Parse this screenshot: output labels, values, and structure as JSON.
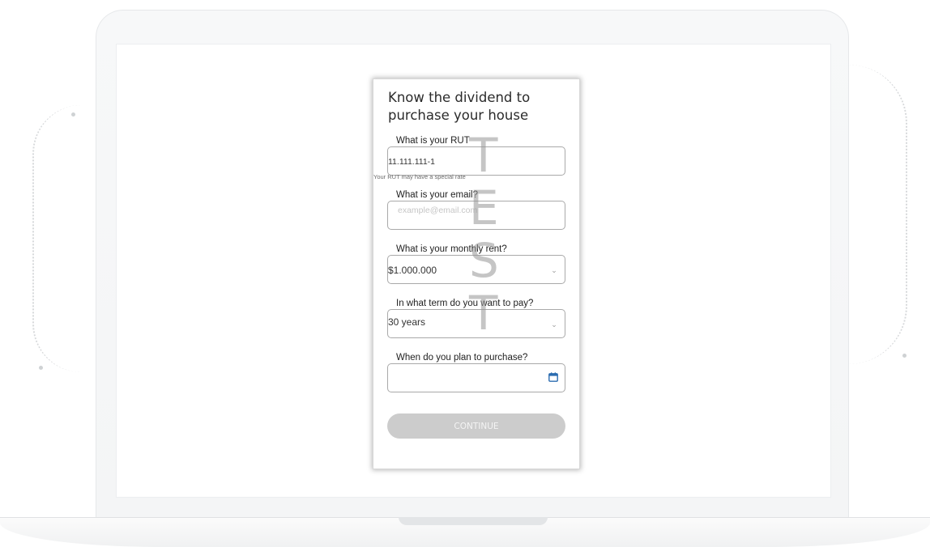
{
  "form": {
    "title": "Know the dividend to purchase your house",
    "rut": {
      "label": "What is your RUT",
      "value": "11.111.111-1",
      "helper": "Your RUT may have a special rate"
    },
    "email": {
      "label": "What is your email?",
      "placeholder": "example@email.com"
    },
    "rent": {
      "label": "What is your monthly rent?",
      "value": "$1.000.000"
    },
    "term": {
      "label": "In what term do you want to pay?",
      "value": "30 years"
    },
    "purchase_date": {
      "label": "When do you plan to purchase?"
    },
    "continue_label": "CONTINUE"
  },
  "watermark": {
    "letters": [
      "T",
      "E",
      "S",
      "T"
    ]
  },
  "colors": {
    "button_disabled": "#cccccc",
    "calendar_icon": "#2b6cb0"
  },
  "icons": {
    "rent_dropdown": "chevron-down-icon",
    "term_dropdown": "chevron-down-icon",
    "purchase_date": "calendar-icon"
  }
}
